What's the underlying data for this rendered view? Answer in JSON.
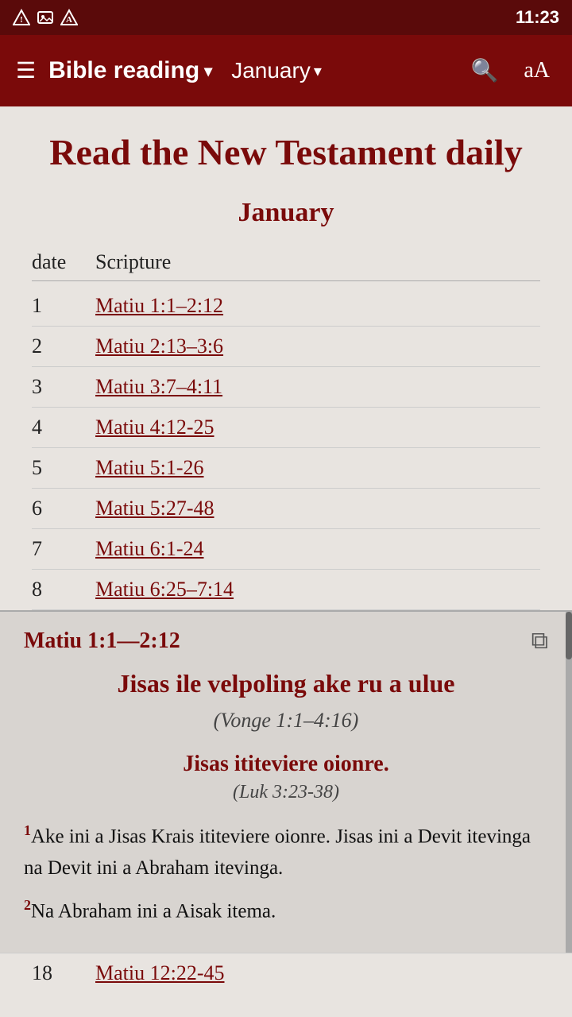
{
  "statusBar": {
    "time": "11:23"
  },
  "toolbar": {
    "menuIcon": "☰",
    "title": "Bible reading",
    "titleDropdown": "▾",
    "month": "January",
    "monthDropdown": "▾",
    "searchIcon": "🔍",
    "fontIcon": "aA"
  },
  "page": {
    "title": "Read the New Testament daily",
    "monthHeading": "January",
    "tableHeaders": {
      "date": "date",
      "scripture": "Scripture"
    },
    "readings": [
      {
        "num": "1",
        "link": "Matiu 1:1–2:12"
      },
      {
        "num": "2",
        "link": "Matiu 2:13–3:6"
      },
      {
        "num": "3",
        "link": "Matiu 3:7–4:11"
      },
      {
        "num": "4",
        "link": "Matiu 4:12-25"
      },
      {
        "num": "5",
        "link": "Matiu 5:1-26"
      },
      {
        "num": "6",
        "link": "Matiu 5:27-48"
      },
      {
        "num": "7",
        "link": "Matiu 6:1-24"
      },
      {
        "num": "8",
        "link": "Matiu 6:25–7:14"
      }
    ],
    "lastRow": {
      "num": "18",
      "link": "Matiu 12:22-45"
    }
  },
  "panel": {
    "ref": "Matiu 1:1—2:12",
    "openIcon": "⧉",
    "passageTitle": "Jisas ile velpoling ake ru a ulue",
    "passageSubtitle": "(Vonge 1:1–4:16)",
    "sectionHeading": "Jisas ititeviere oionre.",
    "sectionRef": "(Luk 3:23-38)",
    "verses": [
      {
        "num": "1",
        "text": "Ake ini a Jisas Krais ititeviere oionre. Jisas ini a Devit itevinga na Devit ini a Abraham itevinga."
      },
      {
        "num": "2",
        "text": "Na Abraham ini a Aisak itema."
      }
    ]
  }
}
